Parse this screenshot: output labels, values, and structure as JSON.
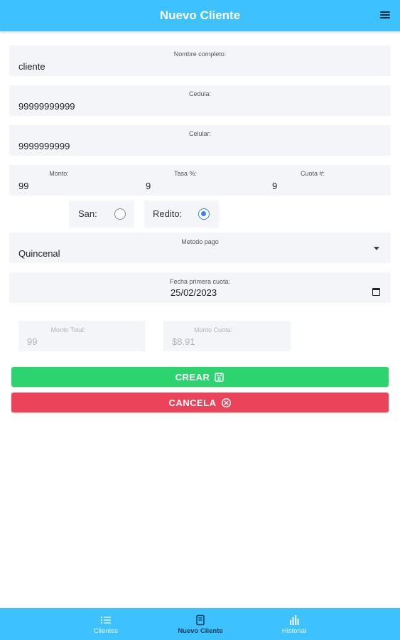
{
  "header": {
    "title": "Nuevo Cliente",
    "menu_icon": "menu-icon"
  },
  "form": {
    "nombre": {
      "label": "Nombre completo:",
      "value": "cliente"
    },
    "cedula": {
      "label": "Cedula:",
      "value": "99999999999"
    },
    "celular": {
      "label": "Celular:",
      "value": "9999999999"
    },
    "monto": {
      "label": "Monto:",
      "value": "99"
    },
    "tasa": {
      "label": "Tasa %:",
      "value": "9"
    },
    "cuota": {
      "label": "Cuota #:",
      "value": "9"
    },
    "tipo": {
      "san_label": "San:",
      "san_checked": false,
      "redito_label": "Redito:",
      "redito_checked": true
    },
    "metodo_pago": {
      "label": "Metodo pago",
      "value": "Quincenal"
    },
    "fecha": {
      "label": "Fecha primera cuota:",
      "value": "25/02/2023"
    },
    "monto_total": {
      "label": "Monto Total:",
      "value": "99"
    },
    "monto_cuota": {
      "label": "Monto Cuota:",
      "value": "$8.91"
    }
  },
  "buttons": {
    "crear": "CREAR",
    "cancela": "CANCELA"
  },
  "colors": {
    "primary": "#3dc2ff",
    "success": "#2dd36f",
    "danger": "#eb445a",
    "radio": "#3880ff"
  },
  "tabs": [
    {
      "label": "Clientes",
      "icon": "list-icon",
      "active": false
    },
    {
      "label": "Nuevo Cliente",
      "icon": "document-icon",
      "active": true
    },
    {
      "label": "Historial",
      "icon": "bar-chart-icon",
      "active": false
    }
  ]
}
